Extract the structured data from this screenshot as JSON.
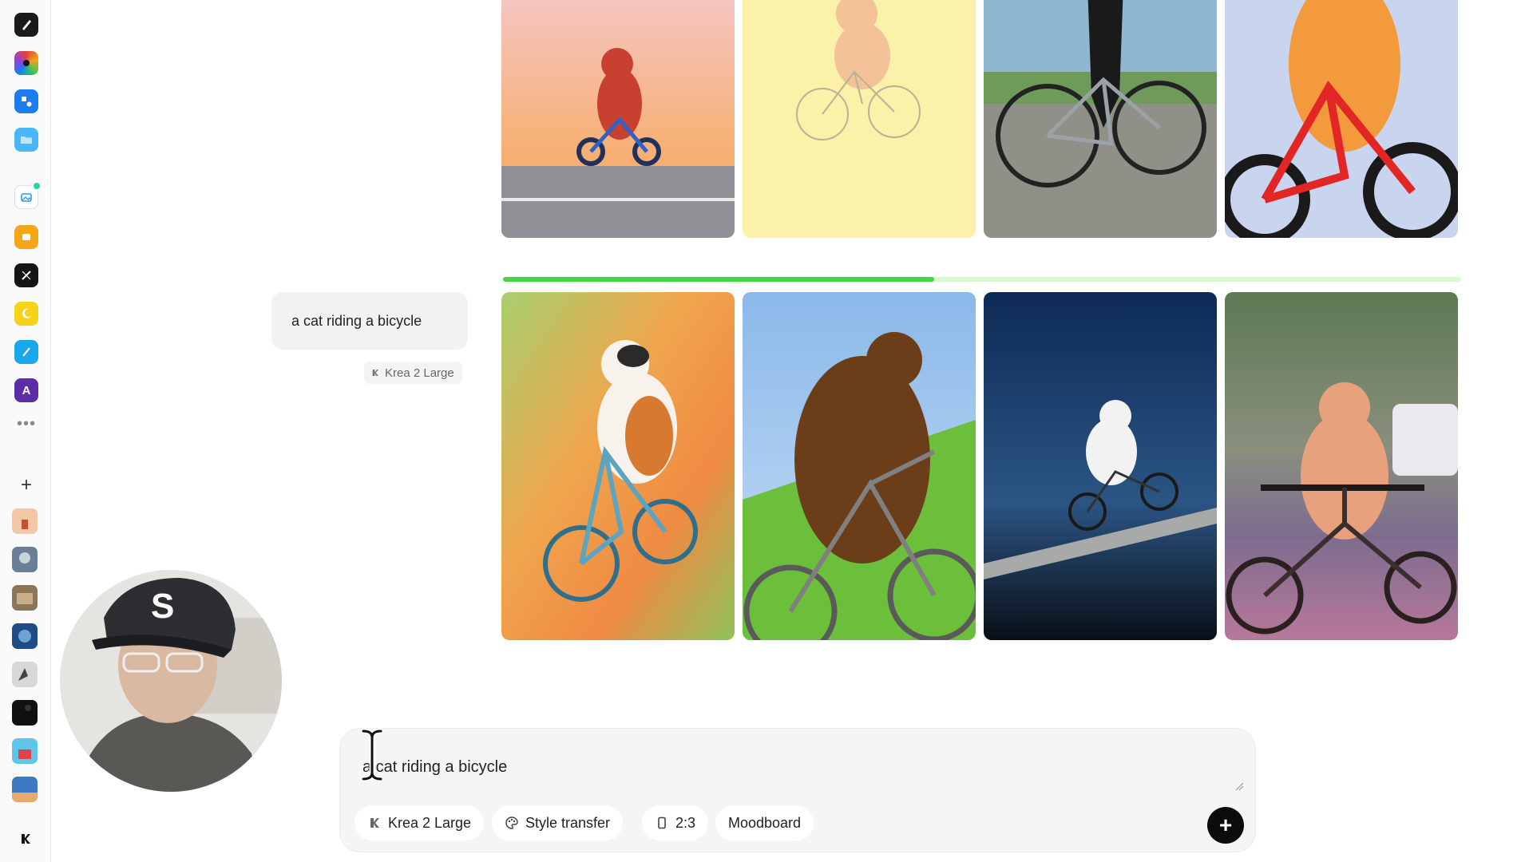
{
  "rail": {
    "apps": [
      {
        "icon": "pen-nib-icon",
        "color": "#1a1a1a"
      },
      {
        "icon": "color-wheel-icon",
        "color": "#e0443a"
      },
      {
        "icon": "shapes-icon",
        "color": "#1d7bf0"
      },
      {
        "icon": "folder-icon",
        "color": "#49b6f5"
      },
      {
        "icon": "image-upload-icon",
        "color": "#2d9cf0"
      },
      {
        "icon": "video-icon",
        "color": "#f5a51a"
      },
      {
        "icon": "wand-icon",
        "color": "#151515"
      },
      {
        "icon": "moon-icon",
        "color": "#f7d21a"
      },
      {
        "icon": "pen-tool-icon",
        "color": "#1aa7ec"
      },
      {
        "icon": "letter-a-icon",
        "color": "#5b2ea8",
        "label": "A"
      }
    ],
    "more_label": "•••",
    "add_label": "+"
  },
  "thread": {
    "prompt": "a cat riding a bicycle",
    "model_tag": "Krea 2 Large"
  },
  "generation": {
    "progress_fraction": 0.45
  },
  "composer": {
    "value": "a cat riding a bicycle",
    "chips": {
      "model": "Krea 2 Large",
      "style": "Style transfer",
      "ratio": "2:3",
      "moodboard": "Moodboard"
    },
    "submit_label": "+"
  },
  "colors": {
    "progress": "#3ed842",
    "progress_track": "#d9f8d2",
    "submit": "#0c0c0c"
  }
}
